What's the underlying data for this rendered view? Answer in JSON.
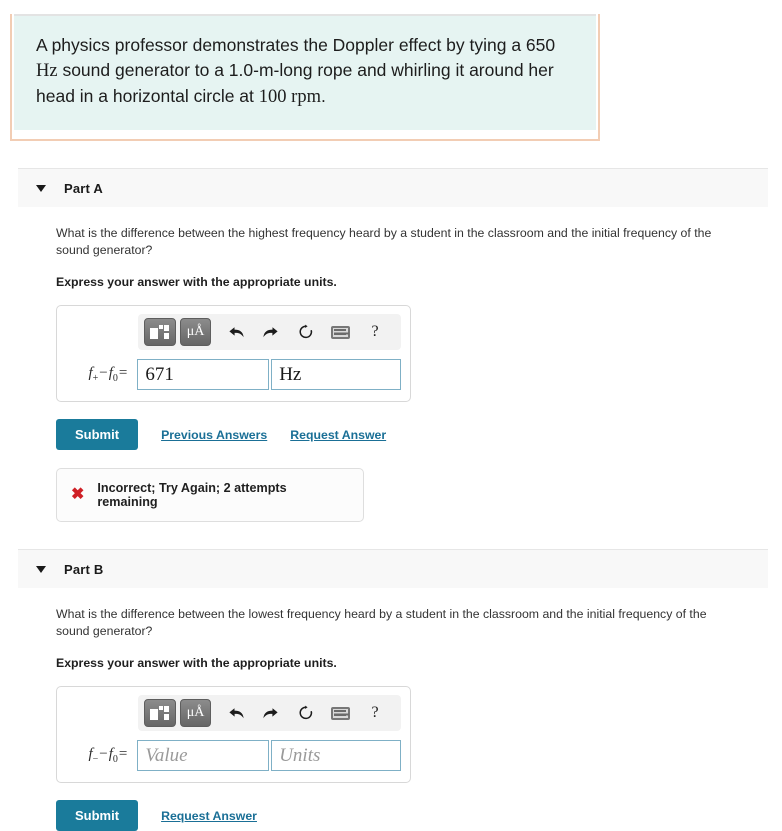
{
  "problem": {
    "text_part1": "A physics professor demonstrates the Doppler effect by tying a 650 ",
    "unit_hz": "Hz",
    "text_part2": " sound generator to a 1.0-m-long rope and whirling it around her head in a horizontal circle at ",
    "rpm": "100 rpm",
    "text_part3": ".",
    "border_color": "#f2cdb4",
    "background_color": "#e6f4f2"
  },
  "parts": [
    {
      "id": "part-a",
      "title": "Part A",
      "question": "What is the difference between the highest frequency heard by a student in the classroom and the initial frequency of the sound generator?",
      "instruction": "Express your answer with the appropriate units.",
      "label_f": "f",
      "label_sub1": "+",
      "label_minus": "−",
      "label_f2": "f",
      "label_sub2": "0",
      "label_eq": "=",
      "value": "671",
      "value_is_placeholder": false,
      "units": "Hz",
      "units_is_placeholder": false,
      "submit_label": "Submit",
      "links": [
        "Previous Answers",
        "Request Answer"
      ],
      "feedback": {
        "icon": "x-mark-icon",
        "text": "Incorrect; Try Again; 2 attempts remaining",
        "color": "#cf2026"
      }
    },
    {
      "id": "part-b",
      "title": "Part B",
      "question": "What is the difference between the lowest frequency heard by a student in the classroom and the initial frequency of the sound generator?",
      "instruction": "Express your answer with the appropriate units.",
      "label_f": "f",
      "label_sub1": "−",
      "label_minus": "−",
      "label_f2": "f",
      "label_sub2": "0",
      "label_eq": "=",
      "value": "Value",
      "value_is_placeholder": true,
      "units": "Units",
      "units_is_placeholder": true,
      "submit_label": "Submit",
      "links": [
        "Request Answer"
      ],
      "feedback": null
    }
  ],
  "toolbar": {
    "template_button": "math-template-icon",
    "units_button": "μÅ",
    "undo_button": "undo-arrow-icon",
    "redo_button": "redo-arrow-icon",
    "reset_button": "reset-circle-icon",
    "keyboard_button": "keyboard-icon",
    "help_button": "?"
  },
  "colors": {
    "submit": "#1a7b9b",
    "link": "#1a6f96",
    "field_border": "#7fb0c6",
    "header_bg": "#f8f8f8"
  }
}
